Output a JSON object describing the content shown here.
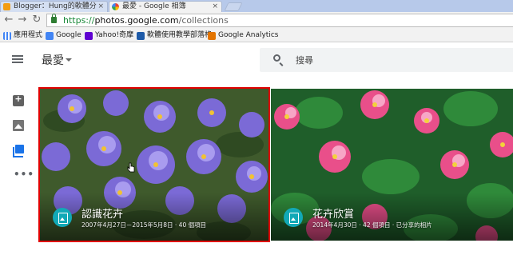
{
  "browser": {
    "tabs": [
      {
        "title": "Blogger：Hung的軟體分",
        "active": false
      },
      {
        "title": "最愛 - Google 相簿",
        "active": true
      }
    ],
    "url_protocol": "https://",
    "url_host": "photos.google.com",
    "url_path": "/collections",
    "bookmarks": [
      {
        "label": "應用程式",
        "icon": "apps-grid-icon",
        "color": "#4285f4"
      },
      {
        "label": "Google",
        "icon": "google-g-icon",
        "color": "#4285f4"
      },
      {
        "label": "Yahoo!奇摩",
        "icon": "yahoo-y-icon",
        "color": "#5f01d1"
      },
      {
        "label": "軟體使用教學部落格",
        "icon": "blogger-b-icon",
        "color": "#1e5aa8"
      },
      {
        "label": "Google Analytics",
        "icon": "analytics-icon",
        "color": "#e37400"
      }
    ]
  },
  "app": {
    "title": "最愛",
    "search_placeholder": "搜尋",
    "rail_icons": [
      "assistant-icon",
      "photos-icon",
      "albums-icon",
      "more-icon"
    ],
    "rail_more_label": "•••",
    "accent_color": "#1a73e8"
  },
  "albums": [
    {
      "title": "認識花卉",
      "meta": "2007年4月27日－2015年5月8日 · 40 個項目",
      "selected": true,
      "highlight_color": "#e00000"
    },
    {
      "title": "花卉欣賞",
      "meta": "2014年4月30日 · 42 個項目 · 已分享的相片",
      "selected": false
    }
  ]
}
